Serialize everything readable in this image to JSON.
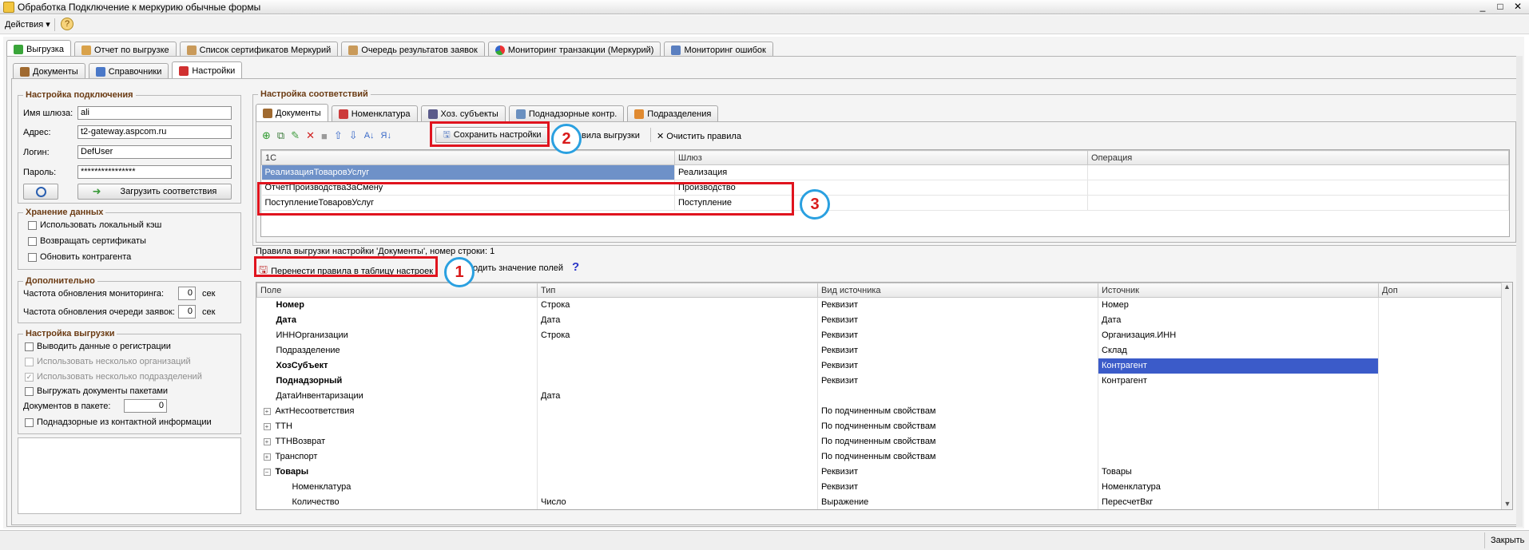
{
  "window": {
    "title": "Обработка  Подключение к меркурию обычные формы",
    "controls": [
      "_",
      "□",
      "✕"
    ]
  },
  "menu": {
    "actions_label": "Действия",
    "help_label": "?"
  },
  "main_tabs": [
    "Выгрузка",
    "Отчет по выгрузке",
    "Список сертификатов Меркурий",
    "Очередь результатов заявок",
    "Мониторинг транзакции (Меркурий)",
    "Мониторинг ошибок"
  ],
  "sub_tabs": [
    "Документы",
    "Справочники",
    "Настройки"
  ],
  "connection": {
    "title": "Настройка подключения",
    "gateway_label": "Имя шлюза:",
    "gateway_value": "ali",
    "address_label": "Адрес:",
    "address_value": "t2-gateway.aspcom.ru",
    "login_label": "Логин:",
    "login_value": "DefUser",
    "password_label": "Пароль:",
    "password_value": "****************",
    "load_button": "Загрузить соответствия"
  },
  "storage": {
    "title": "Хранение данных",
    "items": [
      "Использовать локальный кэш",
      "Возвращать сертификаты",
      "Обновить контрагента"
    ]
  },
  "extra": {
    "title": "Дополнительно",
    "monitor_label": "Частота обновления мониторинга:",
    "monitor_value": "0",
    "monitor_unit": "сек",
    "queue_label": "Частота обновления очереди заявок:",
    "queue_value": "0",
    "queue_unit": "сек"
  },
  "export_settings": {
    "title": "Настройка выгрузки",
    "items": [
      "Выводить данные о регистрации",
      "Использовать несколько организаций",
      "Использовать несколько подразделений",
      "Выгружать документы пакетами"
    ],
    "docs_per_pack_label": "Документов в пакете:",
    "docs_per_pack_value": "0",
    "last_item": "Поднадзорные из контактной информации"
  },
  "mapping": {
    "title": "Настройка соответствий",
    "tabs": [
      "Документы",
      "Номенклатура",
      "Хоз. субъекты",
      "Поднадзорные контр.",
      "Подразделения"
    ],
    "save_button": "Сохранить настройки",
    "rules_partial": "вила выгрузки",
    "clear_button": "Очистить правила",
    "columns": [
      "1С",
      "Шлюз",
      "Операция"
    ],
    "rows": [
      [
        "РеализацияТоваровУслуг",
        "Реализация",
        ""
      ],
      [
        "ОтчетПроизводстваЗаСмену",
        "Производство",
        ""
      ],
      [
        "ПоступлениеТоваровУслуг",
        "Поступление",
        ""
      ]
    ]
  },
  "rules": {
    "caption": "Правила выгрузки настройки 'Документы', номер строки: 1",
    "transfer_button": "Перенести правила в таблицу настроек",
    "fill_partial": "одить значение полей",
    "columns": [
      "Поле",
      "Тип",
      "Вид источника",
      "Источник",
      "Доп"
    ],
    "rows": [
      {
        "field": "Номер",
        "type": "Строка",
        "kind": "Реквизит",
        "source": "Номер",
        "bold": true,
        "exp": ""
      },
      {
        "field": "Дата",
        "type": "Дата",
        "kind": "Реквизит",
        "source": "Дата",
        "bold": true,
        "exp": ""
      },
      {
        "field": "ИННОрганизации",
        "type": "Строка",
        "kind": "Реквизит",
        "source": "Организация.ИНН",
        "bold": false,
        "exp": ""
      },
      {
        "field": "Подразделение",
        "type": "",
        "kind": "Реквизит",
        "source": "Склад",
        "bold": false,
        "exp": ""
      },
      {
        "field": "ХозСубъект",
        "type": "",
        "kind": "Реквизит",
        "source": "Контрагент",
        "bold": true,
        "exp": "",
        "selected": true
      },
      {
        "field": "Поднадзорный",
        "type": "",
        "kind": "Реквизит",
        "source": "Контрагент",
        "bold": true,
        "exp": ""
      },
      {
        "field": "ДатаИнвентаризации",
        "type": "Дата",
        "kind": "",
        "source": "",
        "bold": false,
        "exp": ""
      },
      {
        "field": "АктНесоответствия",
        "type": "",
        "kind": "По подчиненным свойствам",
        "source": "",
        "bold": false,
        "exp": "+"
      },
      {
        "field": "ТТН",
        "type": "",
        "kind": "По подчиненным свойствам",
        "source": "",
        "bold": false,
        "exp": "+"
      },
      {
        "field": "ТТНВозврат",
        "type": "",
        "kind": "По подчиненным свойствам",
        "source": "",
        "bold": false,
        "exp": "+"
      },
      {
        "field": "Транспорт",
        "type": "",
        "kind": "По подчиненным свойствам",
        "source": "",
        "bold": false,
        "exp": "+"
      },
      {
        "field": "Товары",
        "type": "",
        "kind": "Реквизит",
        "source": "Товары",
        "bold": true,
        "exp": "−"
      },
      {
        "field": "Номенклатура",
        "type": "",
        "kind": "Реквизит",
        "source": "Номенклатура",
        "bold": false,
        "exp": "",
        "indent": true
      },
      {
        "field": "Количество",
        "type": "Число",
        "kind": "Выражение",
        "source": "ПересчетВкг",
        "bold": false,
        "exp": "",
        "indent": true
      }
    ]
  },
  "annotations": [
    "1",
    "2",
    "3"
  ],
  "status": {
    "close_label": "Закрыть"
  }
}
